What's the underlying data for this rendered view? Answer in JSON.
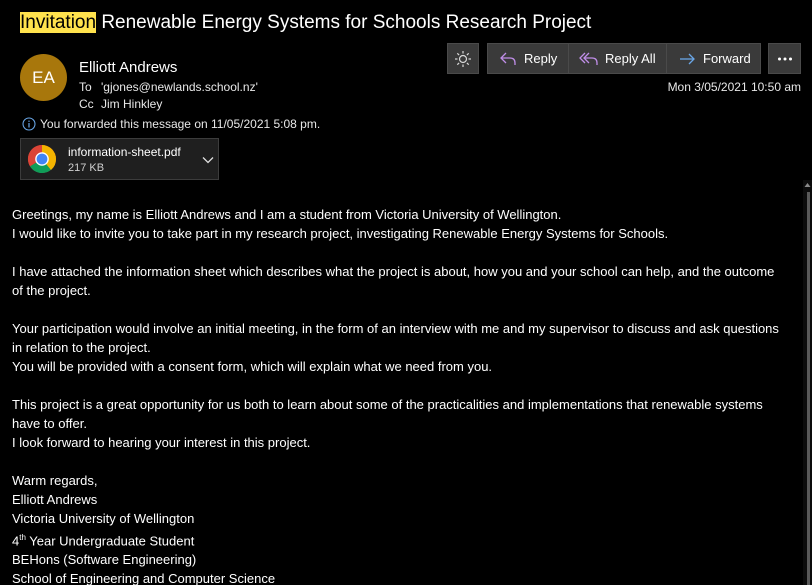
{
  "email": {
    "subject_highlight": "Invitation",
    "subject_rest": " Renewable Energy Systems for Schools Research Project",
    "sender": {
      "initials": "EA",
      "name": "Elliott Andrews",
      "avatar_color": "#a8770c"
    },
    "to_label": "To",
    "to_value": "'gjones@newlands.school.nz'",
    "cc_label": "Cc",
    "cc_value": "Jim Hinkley",
    "date": "Mon 3/05/2021 10:50 am",
    "forward_note": "You forwarded this message on 11/05/2021 5:08 pm.",
    "attachment": {
      "name": "information-sheet.pdf",
      "size": "217 KB",
      "icon": "chrome-icon"
    },
    "body": {
      "p1_l1": "Greetings, my name is Elliott Andrews and I am a student from Victoria University of Wellington.",
      "p1_l2": "I would like to invite you to take part in my research project, investigating Renewable Energy Systems for Schools.",
      "p2": "I have attached the information sheet which describes what the project is about, how you and your school can help, and the outcome of the project.",
      "p3_l1": "Your participation would involve an initial meeting, in the form of an interview with me and my supervisor to discuss and ask questions in relation to the project.",
      "p3_l2": "You will be provided with a consent form, which will explain what we need from you.",
      "p4_l1": "This project is a great opportunity for us both to learn about some of the practicalities and implementations that renewable systems have to offer.",
      "p4_l2": "I look forward to hearing your interest in this project.",
      "sig_regards": "Warm regards,",
      "sig_name": "Elliott Andrews",
      "sig_uni": "Victoria University of Wellington",
      "sig_year_num": "4",
      "sig_year_sup": "th",
      "sig_year_rest": " Year Undergraduate Student",
      "sig_degree": "BEHons (Software Engineering)",
      "sig_school": "School of Engineering and Computer Science"
    }
  },
  "toolbar": {
    "brightness_icon": "sun-icon",
    "reply_label": "Reply",
    "reply_all_label": "Reply All",
    "forward_label": "Forward",
    "more_icon": "more-icon"
  },
  "colors": {
    "background": "#000000",
    "subject_highlight": "#ffe24d",
    "reply_icon": "#c08ee8",
    "forward_icon": "#6aa7e8",
    "info_icon": "#6aa7e8"
  }
}
